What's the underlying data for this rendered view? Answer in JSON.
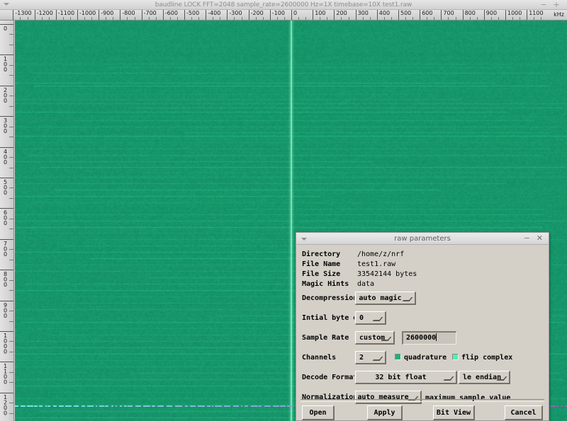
{
  "window": {
    "title": "baudline  LOCK FFT=2048 sample_rate=2600000 Hz=1X timebase=10X  test1.raw",
    "minimize_label": "−",
    "maximize_label": "+"
  },
  "ruler_x": {
    "unit": "kHz",
    "ticks": [
      -1300,
      -1200,
      -1100,
      -1000,
      -900,
      -800,
      -700,
      -600,
      -500,
      -400,
      -300,
      -200,
      -100,
      0,
      100,
      200,
      300,
      400,
      500,
      600,
      700,
      800,
      900,
      1000,
      1100
    ]
  },
  "ruler_y": {
    "ticks": [
      0,
      100,
      200,
      300,
      400,
      500,
      600,
      700,
      800,
      900,
      1000,
      1100,
      1200
    ]
  },
  "spectrogram": {
    "background_color": "#17966a",
    "dc_spike_color": "#aaffdc",
    "bottom_trace_color": "#6f63c8"
  },
  "dialog": {
    "title": "raw parameters",
    "menu_icon": "caret-down-icon",
    "minimize_label": "−",
    "close_label": "✕",
    "info": [
      {
        "label": "Directory",
        "value": "/home/z/nrf"
      },
      {
        "label": "File Name",
        "value": "test1.raw"
      },
      {
        "label": "File Size",
        "value": "33542144 bytes"
      },
      {
        "label": "Magic Hints",
        "value": "data"
      }
    ],
    "decompression": {
      "label": "Decompression",
      "value": "auto magic"
    },
    "initial_byte": {
      "label": "Intial byte offset",
      "value": "0"
    },
    "sample_rate": {
      "label": "Sample Rate",
      "preset": "custom",
      "value": "2600000"
    },
    "channels": {
      "label": "Channels",
      "value": "2",
      "quadrature_label": "quadrature",
      "quadrature_checked": true,
      "quadrature_color": "#18b37a",
      "flip_complex_label": "flip complex",
      "flip_complex_checked": true,
      "flip_complex_color": "#4cf0b8"
    },
    "decode_format": {
      "label": "Decode Format",
      "value": "32 bit float",
      "endian": "le endian"
    },
    "normalization": {
      "label": "Normalization",
      "value": "auto measure",
      "note": "maximum sample value"
    },
    "buttons": {
      "open": "Open",
      "apply": "Apply",
      "bit_view": "Bit View",
      "cancel": "Cancel"
    }
  }
}
